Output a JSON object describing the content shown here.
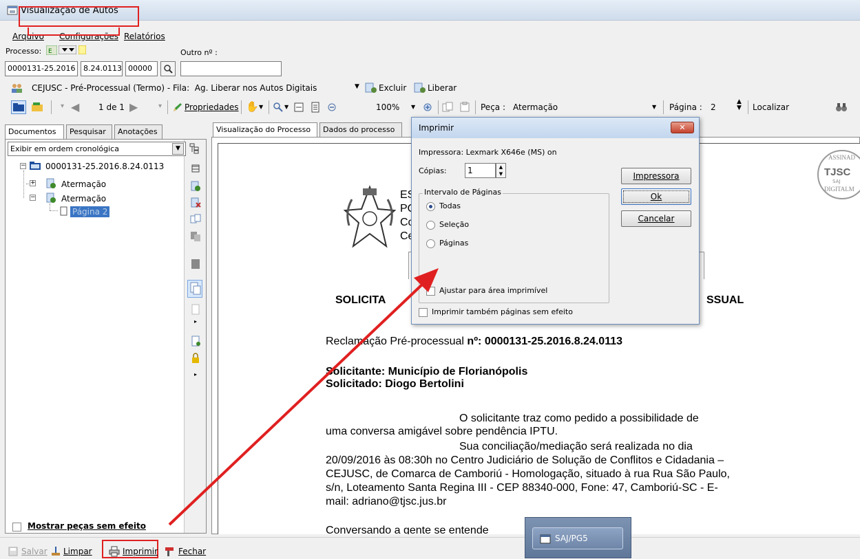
{
  "window": {
    "title": "Visualização de Autos"
  },
  "menu": {
    "arquivo": "Arquivo",
    "configuracoes": "Configurações",
    "relatorios": "Relatórios"
  },
  "process": {
    "label": "Processo:",
    "outro_label": "Outro nº :",
    "num1": "0000131-25.2016",
    "num2": "8.24.0113",
    "num3": "00000",
    "outro_value": ""
  },
  "info_line": {
    "text": "CEJUSC - Pré-Processual (Termo) - Fila:  Ag. Liberar nos Autos Digitais",
    "excluir": "Excluir",
    "liberar": "Liberar"
  },
  "toolbar": {
    "page_count": "1 de 1",
    "propriedades": "Propriedades",
    "zoom": "100%",
    "peca_label": "Peça :",
    "peca_value": "Atermação",
    "pagina_label": "Página :",
    "pagina_value": "2",
    "localizar": "Localizar"
  },
  "left_tabs": {
    "documentos": "Documentos",
    "pesquisar": "Pesquisar",
    "anotacoes": "Anotações"
  },
  "order_select": "Exibir em ordem cronológica",
  "tree": {
    "root": "0000131-25.2016.8.24.0113",
    "item1": "Atermação",
    "item2": "Atermação",
    "page": "Página 2"
  },
  "mostrar": "Mostrar peças sem efeito",
  "right_tabs": {
    "visualizacao": "Visualização do Processo",
    "dados": "Dados do processo"
  },
  "document": {
    "header_lines": [
      "ES",
      "PO",
      "Co",
      "Ce"
    ],
    "title_left": "SOLICITA",
    "title_right": "SSUAL",
    "reclamacao_prefix": "Reclamação Pré-processual ",
    "reclamacao_bold": "nº: 0000131-25.2016.8.24.0113",
    "solicitante": "Solicitante: Município de Florianópolis",
    "solicitado": "Solicitado: Diogo Bertolini",
    "para1_l1": "O solicitante traz como pedido a possibilidade de",
    "para1_l2": "uma conversa amigável sobre pendência IPTU.",
    "para2_l1": "Sua conciliação/mediação será realizada no dia",
    "para2_l2": "20/09/2016 às 08:30h no Centro Judiciário de Solução de Conflitos e Cidadania –",
    "para2_l3": "CEJUSC, de Comarca de Camboriú - Homologação, situado à rua Rua São Paulo,",
    "para2_l4": "s/n, Loteamento Santa Regina III - CEP 88340-000, Fone: 47, Camboriú-SC - E-",
    "para2_l5": "mail: adriano@tjsc.jus.br",
    "last_line": "Conversando a gente se entende",
    "seal_text": "TJSC",
    "seal_top": "ASSINAD",
    "seal_bottom": "DIGITALM",
    "seal_sub": "SAJ"
  },
  "dialog": {
    "title": "Imprimir",
    "impressora": "Impressora: Lexmark X646e (MS) on",
    "copias_label": "Cópias:",
    "copias_value": "1",
    "intervalo": "Intervalo de Páginas",
    "todas": "Todas",
    "selecao": "Seleção",
    "paginas": "Páginas",
    "ajustar": "Ajustar para área imprimível",
    "imprimir_tambem": "Imprimir também páginas sem efeito",
    "btn_impressora": "Impressora",
    "btn_ok": "Ok",
    "btn_cancelar": "Cancelar"
  },
  "bottom": {
    "salvar": "Salvar",
    "limpar": "Limpar",
    "imprimir": "Imprimir",
    "fechar": "Fechar"
  },
  "taskbar": {
    "label": "SAJ/PG5"
  },
  "colors": {
    "accent_red": "#e02020",
    "dialog_title": "#c9dbef",
    "selection": "#3a75c4"
  }
}
